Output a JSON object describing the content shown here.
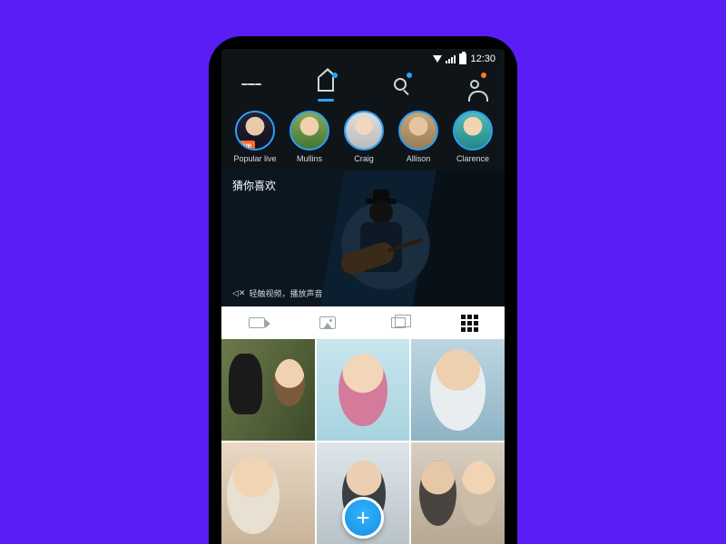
{
  "statusbar": {
    "time": "12:30"
  },
  "topnav": {
    "items": [
      "menu",
      "home",
      "search",
      "profile"
    ],
    "active": "home"
  },
  "stories": [
    {
      "label": "Popular live",
      "live_badge": "Live"
    },
    {
      "label": "Mullins"
    },
    {
      "label": "Craig"
    },
    {
      "label": "Allison"
    },
    {
      "label": "Clarence"
    }
  ],
  "hero": {
    "title": "猜你喜欢",
    "sound_hint": "轻触视频，播放声音"
  },
  "content_tabs": [
    "video",
    "photo",
    "stack",
    "grid"
  ],
  "content_tabs_active": "grid",
  "grid_count": 6,
  "fab_label": "+",
  "colors": {
    "accent": "#2aa3ff",
    "live": "#ff6a2b",
    "bg": "#5a1df5"
  }
}
